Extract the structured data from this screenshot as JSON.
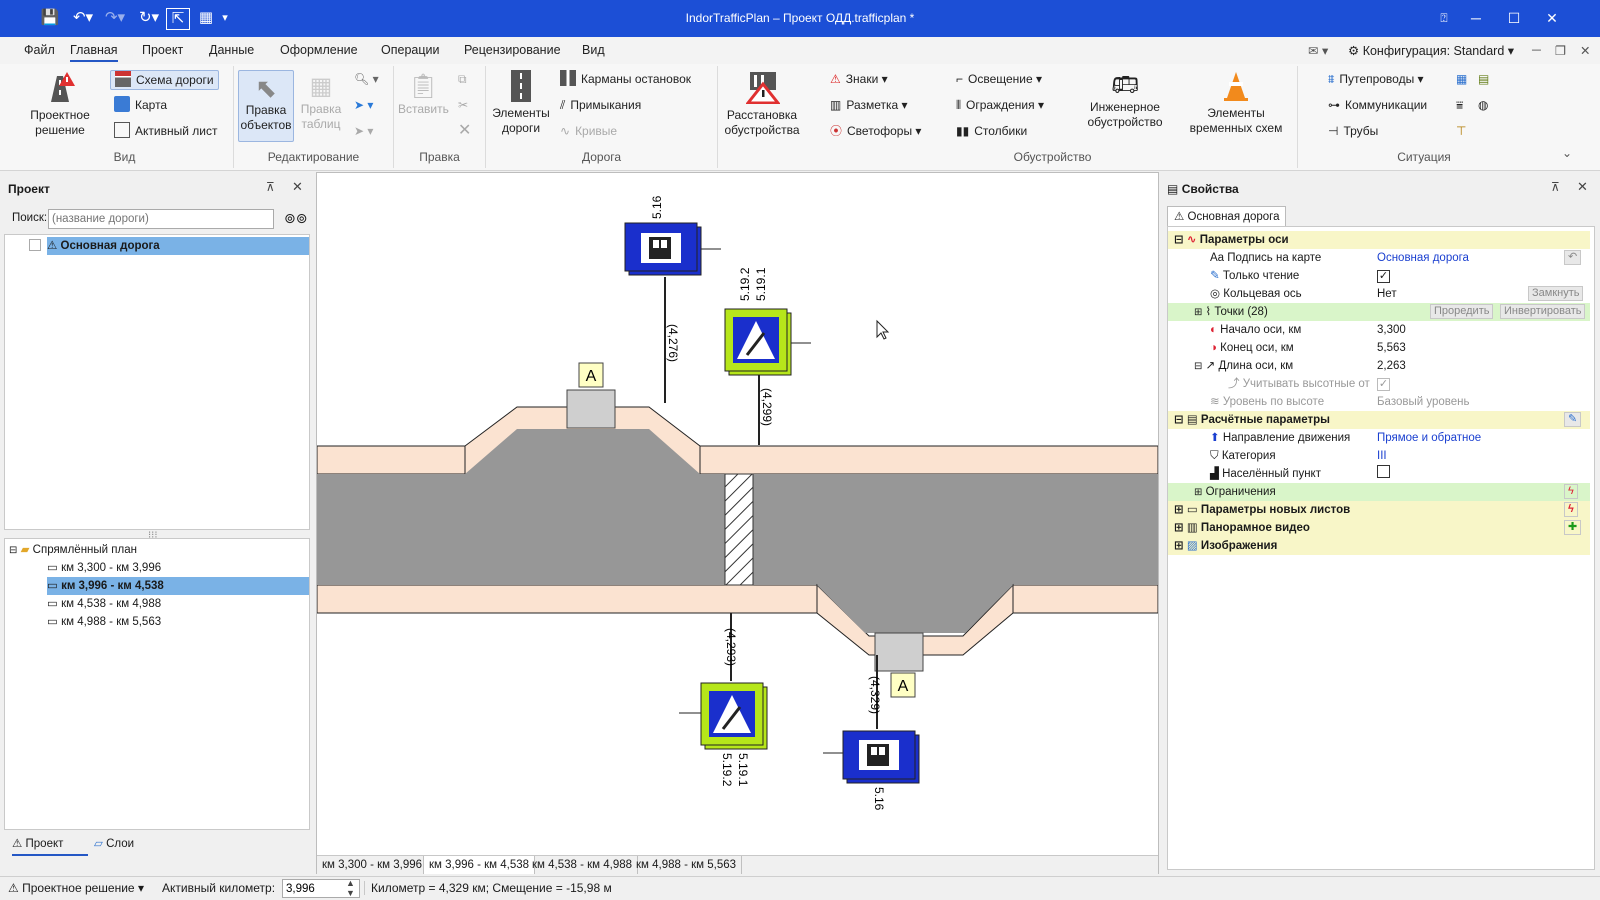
{
  "titlebar": {
    "title": "IndorTrafficPlan – Проект ОДД.trafficplan *",
    "brand_color": "#1c4fd6"
  },
  "menu": {
    "items": [
      "Файл",
      "Главная",
      "Проект",
      "Данные",
      "Оформление",
      "Операции",
      "Рецензирование",
      "Вид"
    ],
    "active": "Главная",
    "config_label": "Конфигурация: Standard"
  },
  "ribbon": {
    "view": {
      "group": "Вид",
      "project_decision": "Проектное решение",
      "road_scheme": "Схема дороги",
      "map": "Карта",
      "active_sheet": "Активный лист"
    },
    "edit": {
      "group": "Редактирование",
      "edit_objects": "Правка объектов",
      "edit_tables": "Правка таблиц"
    },
    "clipboard": {
      "group": "Правка",
      "paste": "Вставить"
    },
    "road": {
      "group": "Дорога",
      "road_elements": "Элементы дороги",
      "bus_stops": "Карманы остановок",
      "junctions": "Примыкания",
      "curves": "Кривые"
    },
    "arrangement": {
      "placement": "Расстановка обустройства"
    },
    "equipment": {
      "group": "Обустройство",
      "signs": "Знаки",
      "marking": "Разметка",
      "traffic_lights": "Светофоры",
      "lighting": "Освещение",
      "fences": "Ограждения",
      "posts": "Столбики",
      "engineering": "Инженерное обустройство",
      "temporary": "Элементы временных схем"
    },
    "situation": {
      "group": "Ситуация",
      "overpasses": "Путепроводы",
      "communications": "Коммуникации",
      "pipes": "Трубы"
    }
  },
  "project_panel": {
    "title": "Проект",
    "search_label": "Поиск:",
    "search_placeholder": "(название дороги)",
    "road_item": "Основная дорога",
    "plan_root": "Спрямлённый план",
    "plan_items": [
      "км 3,300 - км 3,996",
      "км 3,996 - км 4,538",
      "км 4,538 - км 4,988",
      "км 4,988 - км 5,563"
    ],
    "selected_plan": "км 3,996 - км 4,538",
    "tabs": [
      "Проект",
      "Слои"
    ]
  },
  "canvas": {
    "sheet_tabs": [
      "км 3,300 - км 3,996",
      "км 3,996 - км 4,538",
      "км 4,538 - км 4,988",
      "км 4,988 - км 5,563"
    ],
    "active_sheet_tab": "км 3,996 - км 4,538",
    "labels": {
      "sign_top_bus_code": "5.16",
      "dist_top_bus": "(4,276)",
      "sign_top_ped_code_a": "5.19.2",
      "sign_top_ped_code_b": "5.19.1",
      "dist_top_ped": "(4,299)",
      "stop_top_letter": "A",
      "dist_bottom_ped": "(4,293)",
      "sign_bottom_ped_code_a": "5.19.2",
      "sign_bottom_ped_code_b": "5.19.1",
      "stop_bottom_letter": "A",
      "dist_bottom_bus": "(4,329)",
      "sign_bottom_bus_code": "5.16"
    }
  },
  "properties": {
    "title": "Свойства",
    "tab": "Основная дорога",
    "axis_section": "Параметры оси",
    "rows": {
      "caption_label": "Подпись на карте",
      "caption_value": "Основная дорога",
      "readonly_label": "Только чтение",
      "ring_label": "Кольцевая ось",
      "ring_value": "Нет",
      "ring_button": "Замкнуть",
      "points_label": "Точки (28)",
      "points_btn1": "Проредить",
      "points_btn2": "Инвертировать",
      "start_label": "Начало оси, км",
      "start_value": "3,300",
      "end_label": "Конец оси, км",
      "end_value": "5,563",
      "length_label": "Длина оси, км",
      "length_value": "2,263",
      "elev_label": "Учитывать высотные от",
      "level_label": "Уровень по высоте",
      "level_value": "Базовый уровень"
    },
    "calc_section": "Расчётные параметры",
    "calc": {
      "direction_label": "Направление движения",
      "direction_value": "Прямое и обратное",
      "category_label": "Категория",
      "category_value": "III",
      "settlement_label": "Населённый пункт",
      "limits_label": "Ограничения"
    },
    "more_sections": [
      "Параметры новых листов",
      "Панорамное видео",
      "Изображения"
    ]
  },
  "statusbar": {
    "mode": "Проектное решение",
    "active_km_label": "Активный километр:",
    "active_km_value": "3,996",
    "info": "Километр = 4,329 км; Смещение = -15,98 м"
  }
}
